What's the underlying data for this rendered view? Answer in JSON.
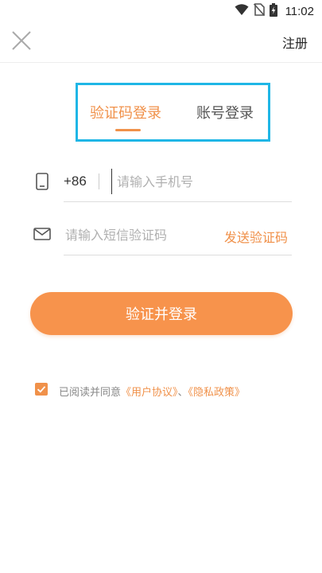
{
  "status_bar": {
    "time": "11:02",
    "icons": [
      "wifi-icon",
      "no-sim-icon",
      "battery-charging-icon"
    ]
  },
  "header": {
    "close_icon": "close-icon",
    "register_label": "注册"
  },
  "tabs": [
    {
      "label": "验证码登录",
      "active": true
    },
    {
      "label": "账号登录",
      "active": false
    }
  ],
  "form": {
    "phone_icon": "phone-icon",
    "country_code": "+86",
    "phone_placeholder": "请输入手机号",
    "phone_value": "",
    "mail_icon": "message-icon",
    "code_placeholder": "请输入短信验证码",
    "code_value": "",
    "send_code_label": "发送验证码"
  },
  "submit": {
    "label": "验证并登录"
  },
  "agreement": {
    "checked": true,
    "prefix": "已阅读并同意",
    "user_agreement": "《用户协议》",
    "separator": "、",
    "privacy_policy": "《隐私政策》"
  },
  "colors": {
    "accent": "#f0914a",
    "button": "#f7934c",
    "highlight_border": "#1fb6e6",
    "placeholder": "#b0b0b0"
  }
}
